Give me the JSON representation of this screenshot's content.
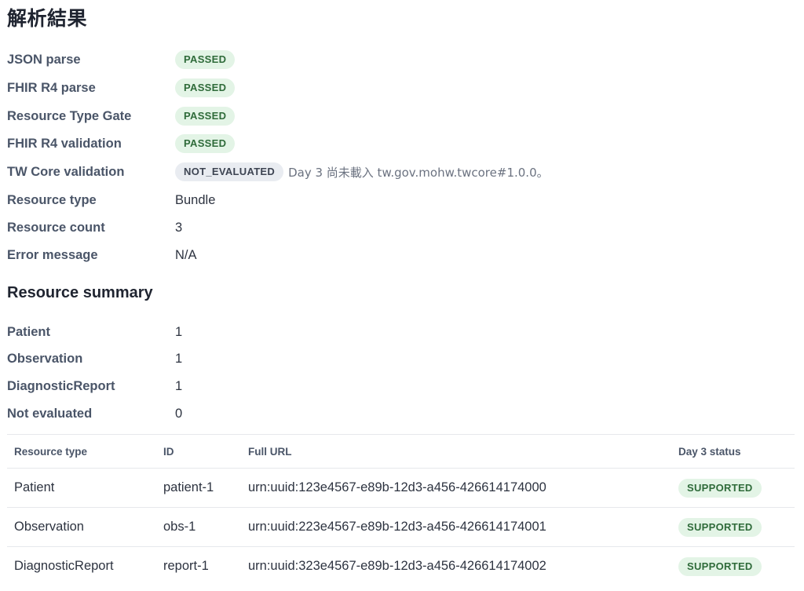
{
  "title": "解析結果",
  "checks": [
    {
      "label": "JSON parse",
      "status": "PASSED"
    },
    {
      "label": "FHIR R4 parse",
      "status": "PASSED"
    },
    {
      "label": "Resource Type Gate",
      "status": "PASSED"
    },
    {
      "label": "FHIR R4 validation",
      "status": "PASSED"
    },
    {
      "label": "TW Core validation",
      "status": "NOT_EVALUATED",
      "note": "Day 3 尚未載入 tw.gov.mohw.twcore#1.0.0。"
    }
  ],
  "info": [
    {
      "label": "Resource type",
      "value": "Bundle"
    },
    {
      "label": "Resource count",
      "value": "3"
    },
    {
      "label": "Error message",
      "value": "N/A"
    }
  ],
  "summary_heading": "Resource summary",
  "summary": [
    {
      "label": "Patient",
      "value": "1"
    },
    {
      "label": "Observation",
      "value": "1"
    },
    {
      "label": "DiagnosticReport",
      "value": "1"
    },
    {
      "label": "Not evaluated",
      "value": "0"
    }
  ],
  "table": {
    "headers": [
      "Resource type",
      "ID",
      "Full URL",
      "Day 3 status"
    ],
    "rows": [
      {
        "type": "Patient",
        "id": "patient-1",
        "url": "urn:uuid:123e4567-e89b-12d3-a456-426614174000",
        "status": "SUPPORTED"
      },
      {
        "type": "Observation",
        "id": "obs-1",
        "url": "urn:uuid:223e4567-e89b-12d3-a456-426614174001",
        "status": "SUPPORTED"
      },
      {
        "type": "DiagnosticReport",
        "id": "report-1",
        "url": "urn:uuid:323e4567-e89b-12d3-a456-426614174002",
        "status": "SUPPORTED"
      }
    ]
  },
  "colors": {
    "passed_bg": "#e3f4e6",
    "passed_text": "#2f6b3a",
    "not_evaluated_bg": "#e9ecf1",
    "not_evaluated_text": "#3d4452"
  }
}
